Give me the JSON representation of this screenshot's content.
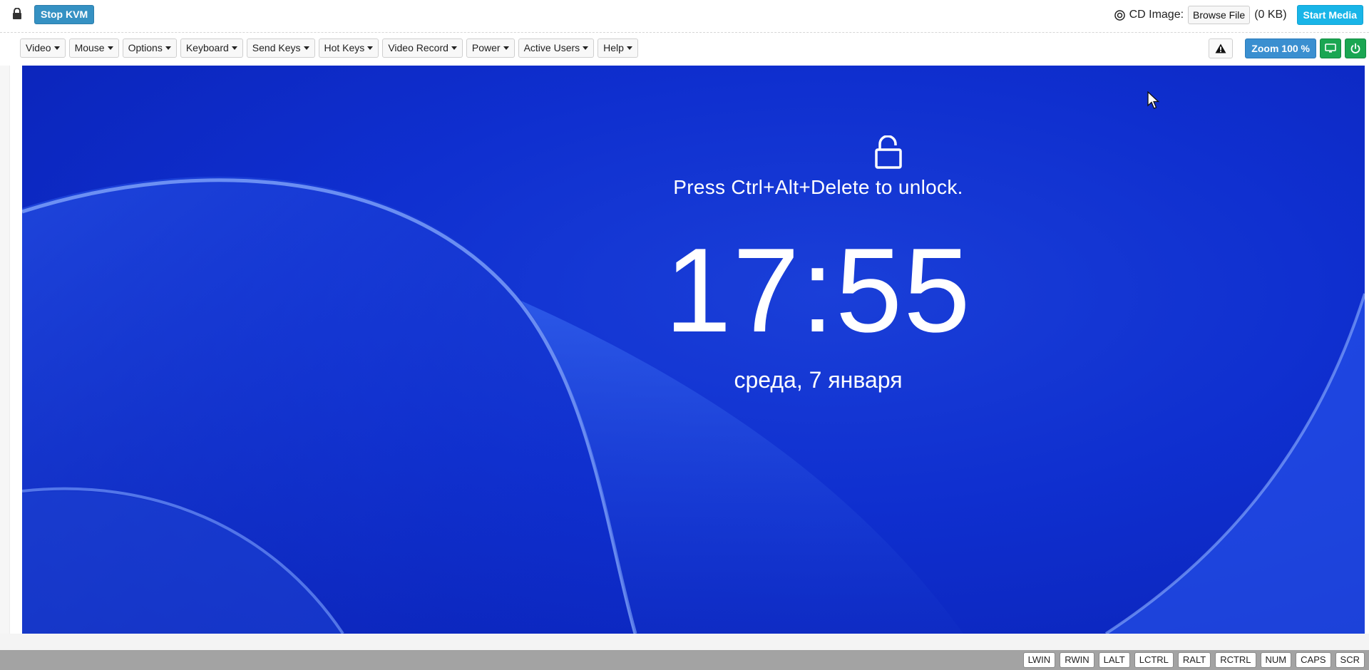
{
  "topbar": {
    "stop_kvm": "Stop KVM",
    "cd_label": "CD Image:",
    "browse_file": "Browse File",
    "file_size": "(0 KB)",
    "start_media": "Start Media"
  },
  "menu": {
    "items": [
      {
        "label": "Video"
      },
      {
        "label": "Mouse"
      },
      {
        "label": "Options"
      },
      {
        "label": "Keyboard"
      },
      {
        "label": "Send Keys"
      },
      {
        "label": "Hot Keys"
      },
      {
        "label": "Video Record"
      },
      {
        "label": "Power"
      },
      {
        "label": "Active Users"
      },
      {
        "label": "Help"
      }
    ],
    "zoom": "Zoom 100 %"
  },
  "screen": {
    "prompt": "Press Ctrl+Alt+Delete to unlock.",
    "time": "17:55",
    "date": "среда, 7 января"
  },
  "keys": [
    "LWIN",
    "RWIN",
    "LALT",
    "LCTRL",
    "RALT",
    "RCTRL",
    "NUM",
    "CAPS",
    "SCR"
  ],
  "colors": {
    "stop_kvm": "#3591c3",
    "start_media": "#19b5e8",
    "zoom": "#3a8fd0",
    "green": "#1aa652",
    "screen_blue": "#0f2fcf",
    "bottom_bar": "#a3a3a3"
  },
  "icons": {
    "lock": "lock-icon",
    "cd": "cd-icon",
    "warning": "warning-icon",
    "monitor": "monitor-icon",
    "power": "power-icon",
    "unlock": "unlock-icon",
    "cursor": "mouse-cursor-icon"
  }
}
